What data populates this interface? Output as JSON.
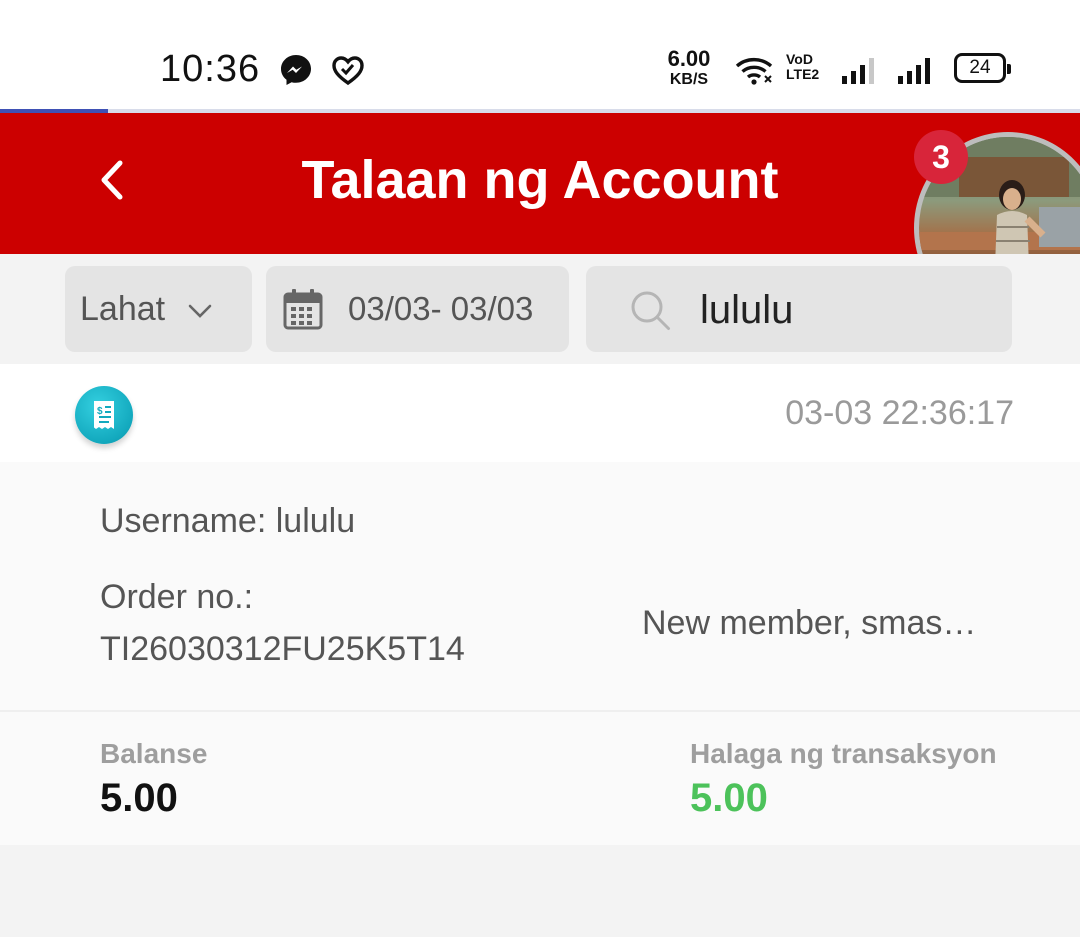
{
  "status_bar": {
    "time": "10:36",
    "net_speed_value": "6.00",
    "net_speed_unit": "KB/S",
    "volte_top": "VoD",
    "volte_bottom": "LTE2",
    "battery": "24",
    "icons": [
      "messenger-icon",
      "heart-app-icon",
      "wifi-icon",
      "signal-1-icon",
      "signal-2-icon",
      "battery-icon"
    ]
  },
  "page_progress": 0.1,
  "header": {
    "title": "Talaan ng Account",
    "back_icon": "chevron-left-icon",
    "notification_count": "3",
    "accent_color": "#cc0000"
  },
  "filters": {
    "type_label": "Lahat",
    "date_range": "03/03- 03/03",
    "search_value": "lululu"
  },
  "record": {
    "icon": "receipt-icon",
    "timestamp": "03-03 22:36:17",
    "username_line": "Username: lululu",
    "order_label": "Order no.:",
    "order_number": "TI26030312FU25K5T14",
    "remark": "New member, smas…",
    "balance_label": "Balanse",
    "balance_value": "5.00",
    "amount_label": "Halaga ng transaksyon",
    "amount_value": "5.00",
    "amount_color": "#4cc25a"
  }
}
